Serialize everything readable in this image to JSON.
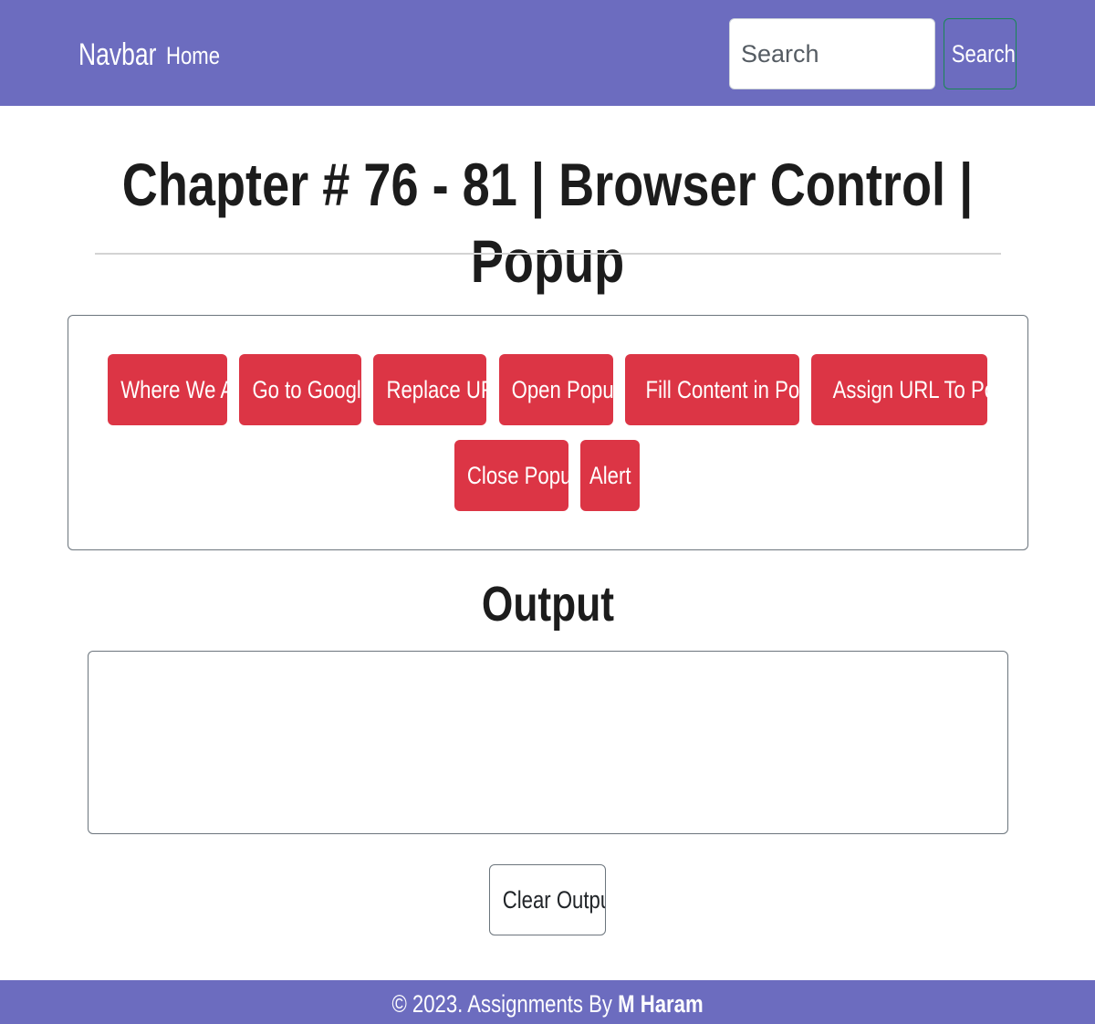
{
  "navbar": {
    "brand": "Navbar",
    "home_link": "Home",
    "search_placeholder": "Search",
    "search_button": "Search"
  },
  "page": {
    "title": "Chapter # 76 - 81 | Browser Control | Popup"
  },
  "buttons": {
    "where_we_at": "Where We At",
    "go_to_google": "Go to Google",
    "replace_url": "Replace URL",
    "open_popup": "Open Popup",
    "fill_content": "Fill Content in Popup",
    "assign_url": "Assign URL To Popup",
    "close_popup": "Close Popup",
    "alert": "Alert"
  },
  "output": {
    "title": "Output",
    "content": "",
    "clear_button": "Clear Output"
  },
  "footer": {
    "prefix": "© 2023. Assignments By ",
    "author": "M Haram"
  },
  "colors": {
    "navbar_bg": "#6c6cbf",
    "danger": "#dc3545",
    "success_border": "#198754"
  }
}
